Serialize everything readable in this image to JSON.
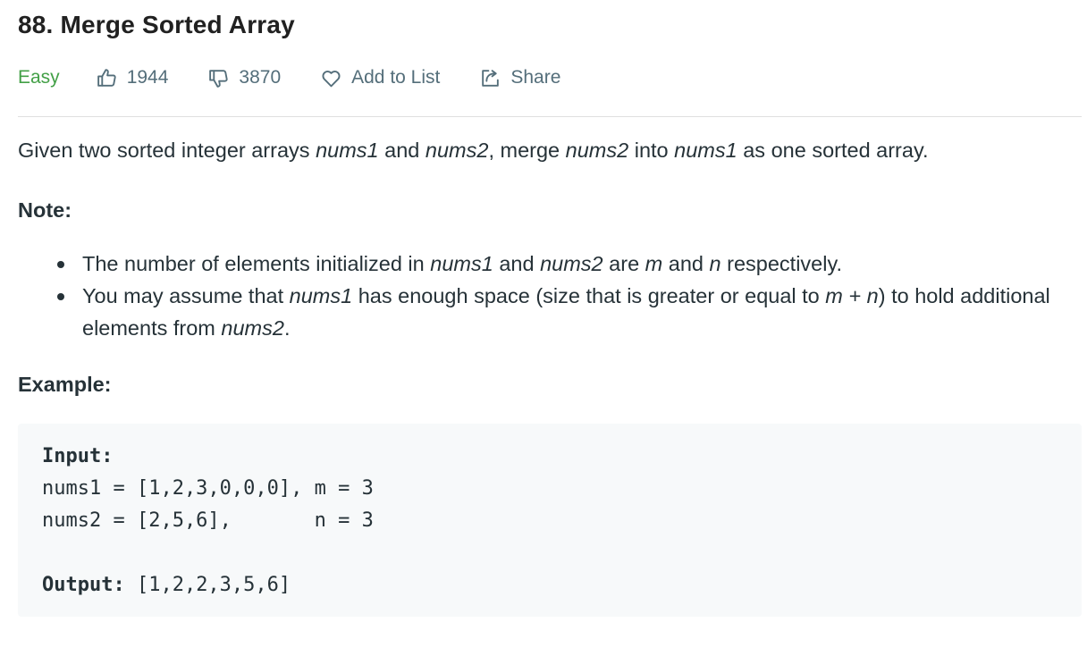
{
  "problem": {
    "title": "88. Merge Sorted Array",
    "difficulty": "Easy",
    "likes": "1944",
    "dislikes": "3870",
    "add_to_list": "Add to List",
    "share": "Share"
  },
  "description": {
    "p1": "Given two sorted integer arrays",
    "nums1": "nums1",
    "and": "and",
    "nums2": "nums2",
    "merge": ", merge",
    "into": "into",
    "end": "as one sorted array."
  },
  "note": {
    "heading": "Note:",
    "item1_a": "The number of elements initialized in",
    "item1_b": "and",
    "item1_c": "are",
    "item1_m": "m",
    "item1_d": "and",
    "item1_n": "n",
    "item1_e": "respectively.",
    "item2_a": "You may assume that",
    "item2_b": "has enough space (size that is greater or equal to",
    "item2_mn": "m + n",
    "item2_c": ") to hold additional elements from",
    "item2_end": "."
  },
  "example": {
    "heading": "Example:",
    "input_label": "Input:",
    "line1": "nums1 = [1,2,3,0,0,0], m = 3",
    "line2": "nums2 = [2,5,6],       n = 3",
    "output_label": "Output:",
    "output_value": " [1,2,2,3,5,6]"
  },
  "colors": {
    "easy": "#43a047",
    "meta": "#546e7a",
    "text": "#263238",
    "code_bg": "#f7f9fa"
  },
  "icons": [
    "thumbs-up-icon",
    "thumbs-down-icon",
    "heart-icon",
    "share-icon"
  ]
}
